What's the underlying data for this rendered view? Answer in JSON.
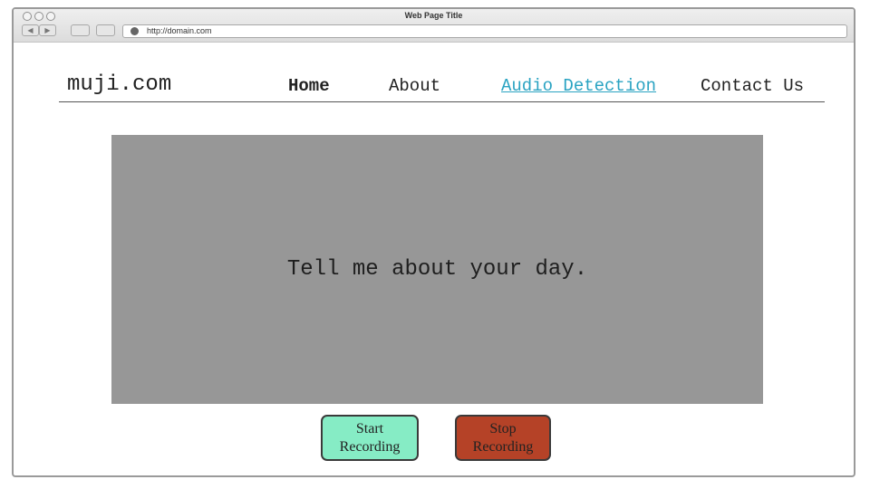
{
  "browser": {
    "window_title": "Web Page Title",
    "url": "http://domain.com",
    "back_icon": "back-arrow-icon",
    "forward_icon": "forward-arrow-icon",
    "back_glyph": "◀",
    "forward_glyph": "▶"
  },
  "site": {
    "logo": "muji.com",
    "nav": {
      "home": "Home",
      "about": "About",
      "audio": "Audio Detection",
      "contact": "Contact Us"
    },
    "active_link_color": "#2aa3c2"
  },
  "main": {
    "prompt": "Tell me about your day.",
    "panel_color": "#979797"
  },
  "controls": {
    "start_line1": "Start",
    "start_line2": "Recording",
    "start_color": "#86ecc5",
    "stop_line1": "Stop",
    "stop_line2": "Recording",
    "stop_color": "#b54227"
  }
}
